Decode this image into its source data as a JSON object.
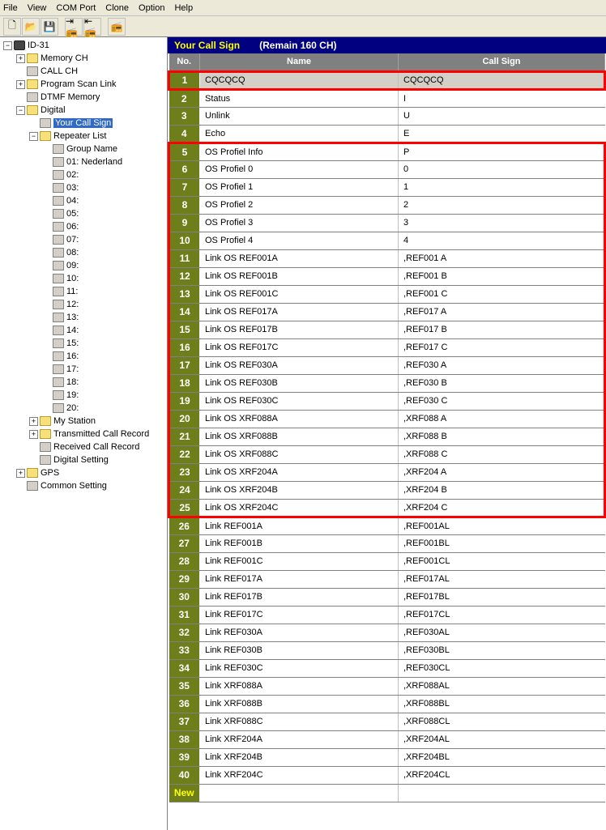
{
  "menu": {
    "items": [
      "File",
      "View",
      "COM Port",
      "Clone",
      "Option",
      "Help"
    ]
  },
  "toolbar": {
    "icons": [
      "new-doc-icon",
      "open-icon",
      "save-icon",
      "",
      "upload-icon",
      "download-icon",
      "",
      "device-icon"
    ]
  },
  "tree": {
    "root": "ID-31",
    "items": [
      {
        "label": "Memory CH",
        "indent": 1,
        "exp": "+",
        "icon": "folder"
      },
      {
        "label": "CALL CH",
        "indent": 1,
        "exp": "",
        "icon": "leaf"
      },
      {
        "label": "Program Scan Link",
        "indent": 1,
        "exp": "+",
        "icon": "folder"
      },
      {
        "label": "DTMF Memory",
        "indent": 1,
        "exp": "",
        "icon": "leaf"
      },
      {
        "label": "Digital",
        "indent": 1,
        "exp": "-",
        "icon": "folder-open"
      },
      {
        "label": "Your Call Sign",
        "indent": 2,
        "exp": "",
        "icon": "leaf",
        "selected": true
      },
      {
        "label": "Repeater List",
        "indent": 2,
        "exp": "-",
        "icon": "folder-open"
      },
      {
        "label": "Group Name",
        "indent": 3,
        "exp": "",
        "icon": "leaf"
      },
      {
        "label": "01: Nederland",
        "indent": 3,
        "exp": "",
        "icon": "leaf"
      },
      {
        "label": "02:",
        "indent": 3,
        "exp": "",
        "icon": "leaf"
      },
      {
        "label": "03:",
        "indent": 3,
        "exp": "",
        "icon": "leaf"
      },
      {
        "label": "04:",
        "indent": 3,
        "exp": "",
        "icon": "leaf"
      },
      {
        "label": "05:",
        "indent": 3,
        "exp": "",
        "icon": "leaf"
      },
      {
        "label": "06:",
        "indent": 3,
        "exp": "",
        "icon": "leaf"
      },
      {
        "label": "07:",
        "indent": 3,
        "exp": "",
        "icon": "leaf"
      },
      {
        "label": "08:",
        "indent": 3,
        "exp": "",
        "icon": "leaf"
      },
      {
        "label": "09:",
        "indent": 3,
        "exp": "",
        "icon": "leaf"
      },
      {
        "label": "10:",
        "indent": 3,
        "exp": "",
        "icon": "leaf"
      },
      {
        "label": "11:",
        "indent": 3,
        "exp": "",
        "icon": "leaf"
      },
      {
        "label": "12:",
        "indent": 3,
        "exp": "",
        "icon": "leaf"
      },
      {
        "label": "13:",
        "indent": 3,
        "exp": "",
        "icon": "leaf"
      },
      {
        "label": "14:",
        "indent": 3,
        "exp": "",
        "icon": "leaf"
      },
      {
        "label": "15:",
        "indent": 3,
        "exp": "",
        "icon": "leaf"
      },
      {
        "label": "16:",
        "indent": 3,
        "exp": "",
        "icon": "leaf"
      },
      {
        "label": "17:",
        "indent": 3,
        "exp": "",
        "icon": "leaf"
      },
      {
        "label": "18:",
        "indent": 3,
        "exp": "",
        "icon": "leaf"
      },
      {
        "label": "19:",
        "indent": 3,
        "exp": "",
        "icon": "leaf"
      },
      {
        "label": "20:",
        "indent": 3,
        "exp": "",
        "icon": "leaf"
      },
      {
        "label": "My Station",
        "indent": 2,
        "exp": "+",
        "icon": "folder"
      },
      {
        "label": "Transmitted Call Record",
        "indent": 2,
        "exp": "+",
        "icon": "folder"
      },
      {
        "label": "Received Call Record",
        "indent": 2,
        "exp": "",
        "icon": "leaf"
      },
      {
        "label": "Digital Setting",
        "indent": 2,
        "exp": "",
        "icon": "leaf"
      },
      {
        "label": "GPS",
        "indent": 1,
        "exp": "+",
        "icon": "folder"
      },
      {
        "label": "Common Setting",
        "indent": 1,
        "exp": "",
        "icon": "leaf"
      }
    ]
  },
  "header": {
    "title": "Your Call Sign",
    "remain": "(Remain 160 CH)"
  },
  "columns": {
    "no": "No.",
    "name": "Name",
    "callsign": "Call Sign"
  },
  "rows": [
    {
      "no": "1",
      "name": "CQCQCQ",
      "call": "CQCQCQ",
      "hl": true,
      "box": 1
    },
    {
      "no": "2",
      "name": "Status",
      "call": "I"
    },
    {
      "no": "3",
      "name": "Unlink",
      "call": "U"
    },
    {
      "no": "4",
      "name": "Echo",
      "call": "E"
    },
    {
      "no": "5",
      "name": "OS Profiel Info",
      "call": "P",
      "box": "top"
    },
    {
      "no": "6",
      "name": "OS Profiel 0",
      "call": "0",
      "box": "mid"
    },
    {
      "no": "7",
      "name": "OS Profiel 1",
      "call": "1",
      "box": "mid"
    },
    {
      "no": "8",
      "name": "OS Profiel 2",
      "call": "2",
      "box": "mid"
    },
    {
      "no": "9",
      "name": "OS Profiel 3",
      "call": "3",
      "box": "mid"
    },
    {
      "no": "10",
      "name": "OS Profiel 4",
      "call": "4",
      "box": "mid"
    },
    {
      "no": "11",
      "name": "Link OS REF001A",
      "call": ",REF001 A",
      "box": "mid"
    },
    {
      "no": "12",
      "name": "Link OS REF001B",
      "call": ",REF001 B",
      "box": "mid"
    },
    {
      "no": "13",
      "name": "Link OS REF001C",
      "call": ",REF001 C",
      "box": "mid"
    },
    {
      "no": "14",
      "name": "Link OS REF017A",
      "call": ",REF017 A",
      "box": "mid"
    },
    {
      "no": "15",
      "name": "Link OS REF017B",
      "call": ",REF017 B",
      "box": "mid"
    },
    {
      "no": "16",
      "name": "Link OS REF017C",
      "call": ",REF017 C",
      "box": "mid"
    },
    {
      "no": "17",
      "name": "Link OS REF030A",
      "call": ",REF030 A",
      "box": "mid"
    },
    {
      "no": "18",
      "name": "Link OS REF030B",
      "call": ",REF030 B",
      "box": "mid"
    },
    {
      "no": "19",
      "name": "Link OS REF030C",
      "call": ",REF030 C",
      "box": "mid"
    },
    {
      "no": "20",
      "name": "Link OS XRF088A",
      "call": ",XRF088 A",
      "box": "mid"
    },
    {
      "no": "21",
      "name": "Link OS XRF088B",
      "call": ",XRF088 B",
      "box": "mid"
    },
    {
      "no": "22",
      "name": "Link OS XRF088C",
      "call": ",XRF088 C",
      "box": "mid"
    },
    {
      "no": "23",
      "name": "Link OS XRF204A",
      "call": ",XRF204 A",
      "box": "mid"
    },
    {
      "no": "24",
      "name": "Link OS XRF204B",
      "call": ",XRF204 B",
      "box": "mid"
    },
    {
      "no": "25",
      "name": "Link OS XRF204C",
      "call": ",XRF204 C",
      "box": "bot"
    },
    {
      "no": "26",
      "name": "Link REF001A",
      "call": ",REF001AL"
    },
    {
      "no": "27",
      "name": "Link REF001B",
      "call": ",REF001BL"
    },
    {
      "no": "28",
      "name": "Link REF001C",
      "call": ",REF001CL"
    },
    {
      "no": "29",
      "name": "Link REF017A",
      "call": ",REF017AL"
    },
    {
      "no": "30",
      "name": "Link REF017B",
      "call": ",REF017BL"
    },
    {
      "no": "31",
      "name": "Link REF017C",
      "call": ",REF017CL"
    },
    {
      "no": "32",
      "name": "Link REF030A",
      "call": ",REF030AL"
    },
    {
      "no": "33",
      "name": "Link REF030B",
      "call": ",REF030BL"
    },
    {
      "no": "34",
      "name": "Link REF030C",
      "call": ",REF030CL"
    },
    {
      "no": "35",
      "name": "Link XRF088A",
      "call": ",XRF088AL"
    },
    {
      "no": "36",
      "name": "Link XRF088B",
      "call": ",XRF088BL"
    },
    {
      "no": "37",
      "name": "Link XRF088C",
      "call": ",XRF088CL"
    },
    {
      "no": "38",
      "name": "Link XRF204A",
      "call": ",XRF204AL"
    },
    {
      "no": "39",
      "name": "Link XRF204B",
      "call": ",XRF204BL"
    },
    {
      "no": "40",
      "name": "Link XRF204C",
      "call": ",XRF204CL"
    }
  ],
  "newLabel": "New"
}
